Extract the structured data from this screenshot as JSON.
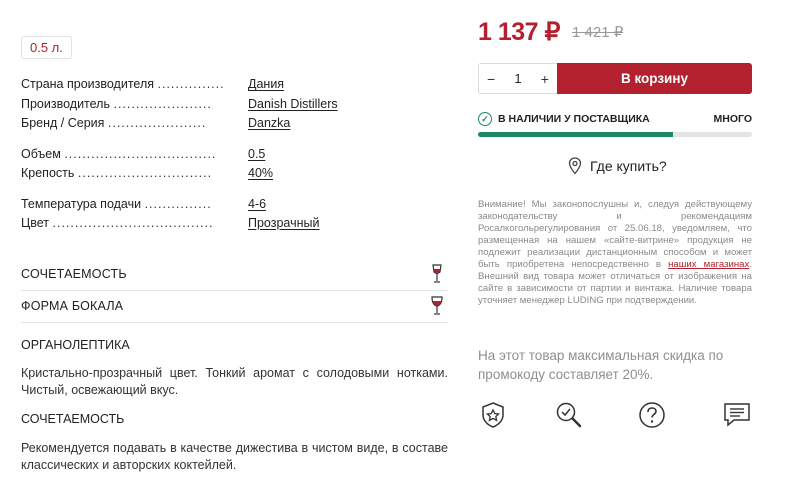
{
  "volume": "0.5 л.",
  "specs": [
    {
      "label": "Страна производителя",
      "dots": "...............",
      "value": "Дания"
    },
    {
      "label": "Производитель",
      "dots": "......................",
      "value": "Danish Distillers"
    },
    {
      "label": "Бренд / Серия",
      "dots": "......................",
      "value": "Danzka"
    },
    {
      "label": "Объем",
      "dots": "..................................",
      "value": "0.5"
    },
    {
      "label": "Крепость",
      "dots": "..............................",
      "value": "40%"
    },
    {
      "label": "Температура подачи",
      "dots": "...............",
      "value": "4-6"
    },
    {
      "label": "Цвет",
      "dots": "....................................",
      "value": "Прозрачный"
    }
  ],
  "accordions": {
    "pairing": "СОЧЕТАЕМОСТЬ",
    "glass": "ФОРМА БОКАЛА"
  },
  "organoleptic": {
    "title": "ОРГАНОЛЕПТИКА",
    "text": "Кристально-прозрачный цвет. Тонкий аромат с солодовыми нотками. Чистый, освежающий вкус."
  },
  "pairing": {
    "title": "СОЧЕТАЕМОСТЬ",
    "text": "Рекомендуется подавать в качестве дижестива в чистом виде, в составе классических и авторских коктейлей."
  },
  "price": {
    "current": "1 137 ₽",
    "old": "1 421 ₽"
  },
  "quantity": {
    "minus": "−",
    "value": "1",
    "plus": "+"
  },
  "cart_label": "В корзину",
  "stock": {
    "status": "В НАЛИЧИИ У ПОСТАВЩИКА",
    "level": "МНОГО",
    "fill_fraction": 0.71
  },
  "where_label": "Где купить?",
  "notice": {
    "text_before": "Внимание! Мы законопослушны и, следуя действующему законодательству и рекомендациям Росалкогольрегулирования от 25.06.18, уведомляем, что размещенная на нашем «сайте-витрине» продукция не подлежит реализации дистанционным способом и может быть приобретена непосредственно в ",
    "link": "наших магазинах",
    "text_after": ". Внешний вид товара может отличаться от изображения на сайте в зависимости от партии и винтажа. Наличие товара уточняет менеджер LUDING при подтверждении."
  },
  "promo": "На этот товар максимальная скидка по промокоду составляет 20%.",
  "action_icons": [
    "star-badge-icon",
    "magnifier-check-icon",
    "question-icon",
    "chat-icon"
  ],
  "colors": {
    "accent": "#b3212f",
    "stock_green": "#1d8a63"
  }
}
